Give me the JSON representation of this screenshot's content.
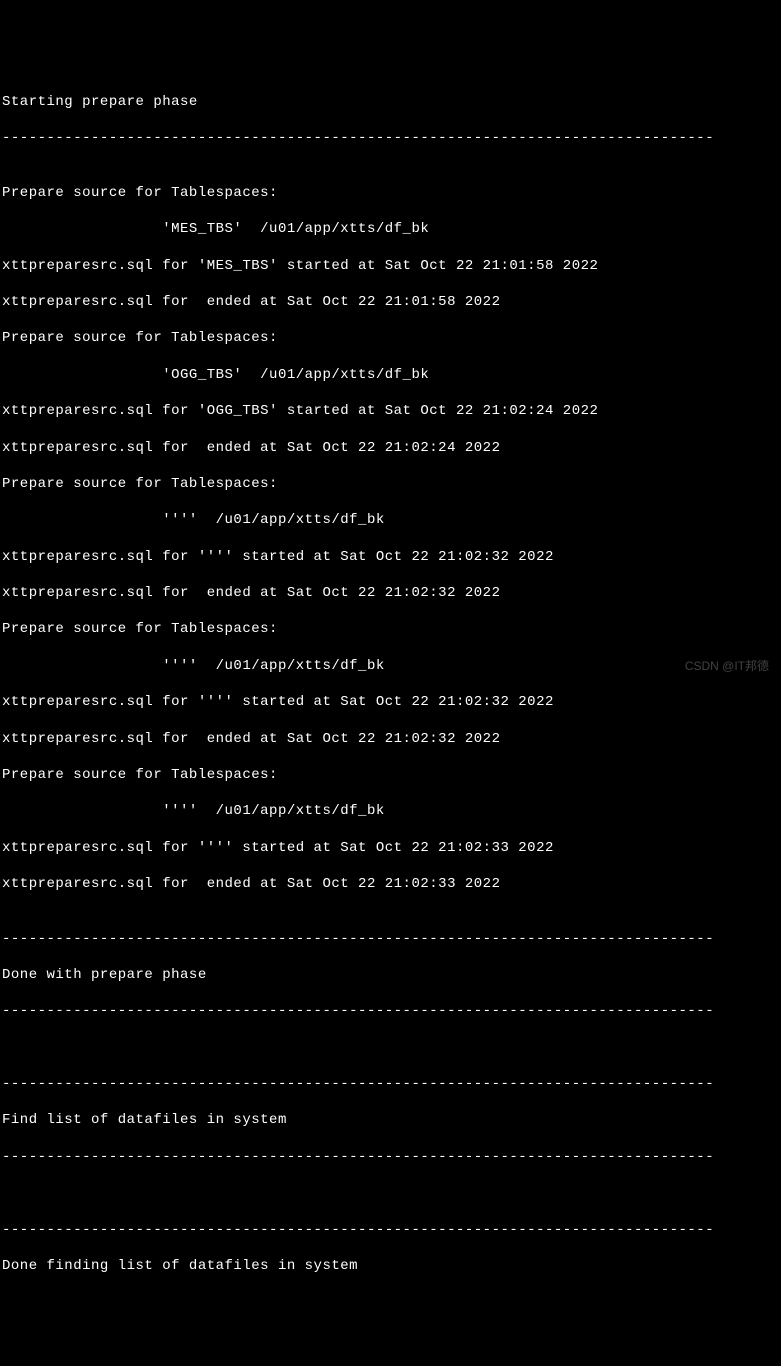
{
  "lines": {
    "l0": "Starting prepare phase",
    "dash": "--------------------------------------------------------------------------------",
    "blank": "",
    "l1": "Prepare source for Tablespaces:",
    "l2": "                  'MES_TBS'  /u01/app/xtts/df_bk",
    "l3": "xttpreparesrc.sql for 'MES_TBS' started at Sat Oct 22 21:01:58 2022",
    "l4": "xttpreparesrc.sql for  ended at Sat Oct 22 21:01:58 2022",
    "l5": "Prepare source for Tablespaces:",
    "l6": "                  'OGG_TBS'  /u01/app/xtts/df_bk",
    "l7": "xttpreparesrc.sql for 'OGG_TBS' started at Sat Oct 22 21:02:24 2022",
    "l8": "xttpreparesrc.sql for  ended at Sat Oct 22 21:02:24 2022",
    "l9": "Prepare source for Tablespaces:",
    "l10": "                  ''''  /u01/app/xtts/df_bk",
    "l11": "xttpreparesrc.sql for '''' started at Sat Oct 22 21:02:32 2022",
    "l12": "xttpreparesrc.sql for  ended at Sat Oct 22 21:02:32 2022",
    "l13": "Prepare source for Tablespaces:",
    "l14": "                  ''''  /u01/app/xtts/df_bk",
    "l15": "xttpreparesrc.sql for '''' started at Sat Oct 22 21:02:32 2022",
    "l16": "xttpreparesrc.sql for  ended at Sat Oct 22 21:02:32 2022",
    "l17": "Prepare source for Tablespaces:",
    "l18": "                  ''''  /u01/app/xtts/df_bk",
    "l19": "xttpreparesrc.sql for '''' started at Sat Oct 22 21:02:33 2022",
    "l20": "xttpreparesrc.sql for  ended at Sat Oct 22 21:02:33 2022",
    "l21": "Done with prepare phase",
    "l22": "Find list of datafiles in system",
    "l23": "Done finding list of datafiles in system"
  },
  "watermark": "CSDN @IT邦德"
}
